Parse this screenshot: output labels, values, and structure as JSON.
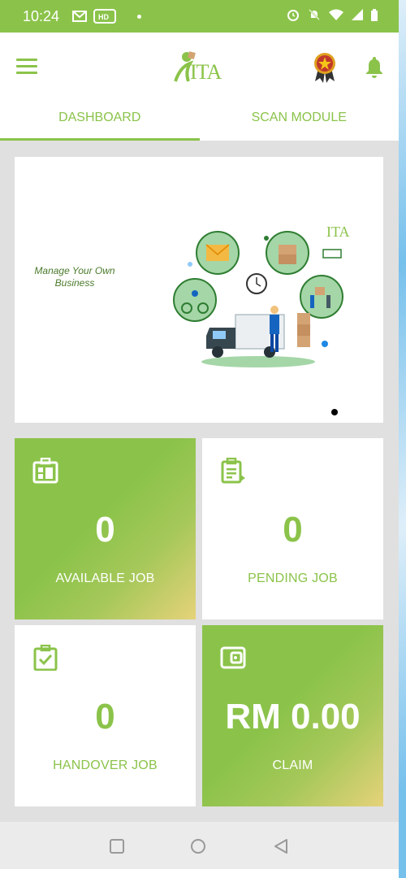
{
  "status_bar": {
    "time": "10:24",
    "left_icons": [
      "gmail-icon",
      "hd-voice-icon"
    ],
    "right_icons": [
      "alarm-icon",
      "bell-off-icon",
      "wifi-icon",
      "signal-icon",
      "battery-icon"
    ]
  },
  "app_bar": {
    "logo_text": "ITA",
    "menu_icon": "hamburger-menu-icon",
    "badge_icon": "award-medal-icon",
    "notification_icon": "bell-icon"
  },
  "tabs": [
    {
      "label": "DASHBOARD",
      "active": true
    },
    {
      "label": "SCAN MODULE",
      "active": false
    }
  ],
  "banner": {
    "caption": "Manage Your Own Business",
    "logo_text": "ITA",
    "slide_indicator_count": 1
  },
  "cards": [
    {
      "value": "0",
      "label": "AVAILABLE JOB",
      "icon": "dashboard-grid-icon",
      "style": "green"
    },
    {
      "value": "0",
      "label": "PENDING JOB",
      "icon": "clipboard-pending-icon",
      "style": "white"
    },
    {
      "value": "0",
      "label": "HANDOVER JOB",
      "icon": "clipboard-check-icon",
      "style": "white"
    },
    {
      "value": "RM 0.00",
      "label": "CLAIM",
      "icon": "wallet-icon",
      "style": "green"
    }
  ],
  "nav_bar": {
    "buttons": [
      "recent-apps-icon",
      "home-icon",
      "back-icon"
    ]
  },
  "colors": {
    "primary": "#8bc34a",
    "gradient_end": "#e6d27a",
    "background": "#e0e0e0"
  }
}
